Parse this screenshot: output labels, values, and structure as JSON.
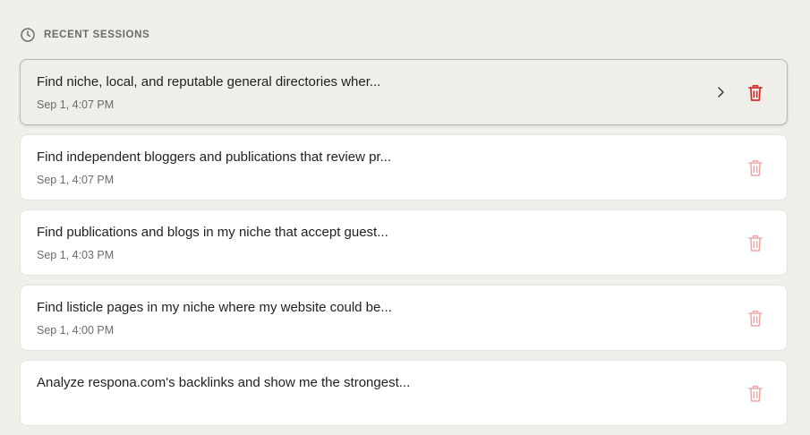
{
  "header": {
    "title": "RECENT SESSIONS",
    "icon": "clock-icon"
  },
  "colors": {
    "background": "#f1efea",
    "active_card": "#f0eee9",
    "trash_active": "#d22b2b",
    "trash_inactive": "#eba5a5"
  },
  "sessions": [
    {
      "title": "Find niche, local, and reputable general directories wher...",
      "date": "Sep 1, 4:07 PM",
      "active": true
    },
    {
      "title": "Find independent bloggers and publications that review pr...",
      "date": "Sep 1, 4:07 PM",
      "active": false
    },
    {
      "title": "Find publications and blogs in my niche that accept guest...",
      "date": "Sep 1, 4:03 PM",
      "active": false
    },
    {
      "title": "Find listicle pages in my niche where my website could be...",
      "date": "Sep 1, 4:00 PM",
      "active": false
    },
    {
      "title": "Analyze respona.com's backlinks and show me the strongest...",
      "date": "",
      "active": false
    }
  ]
}
